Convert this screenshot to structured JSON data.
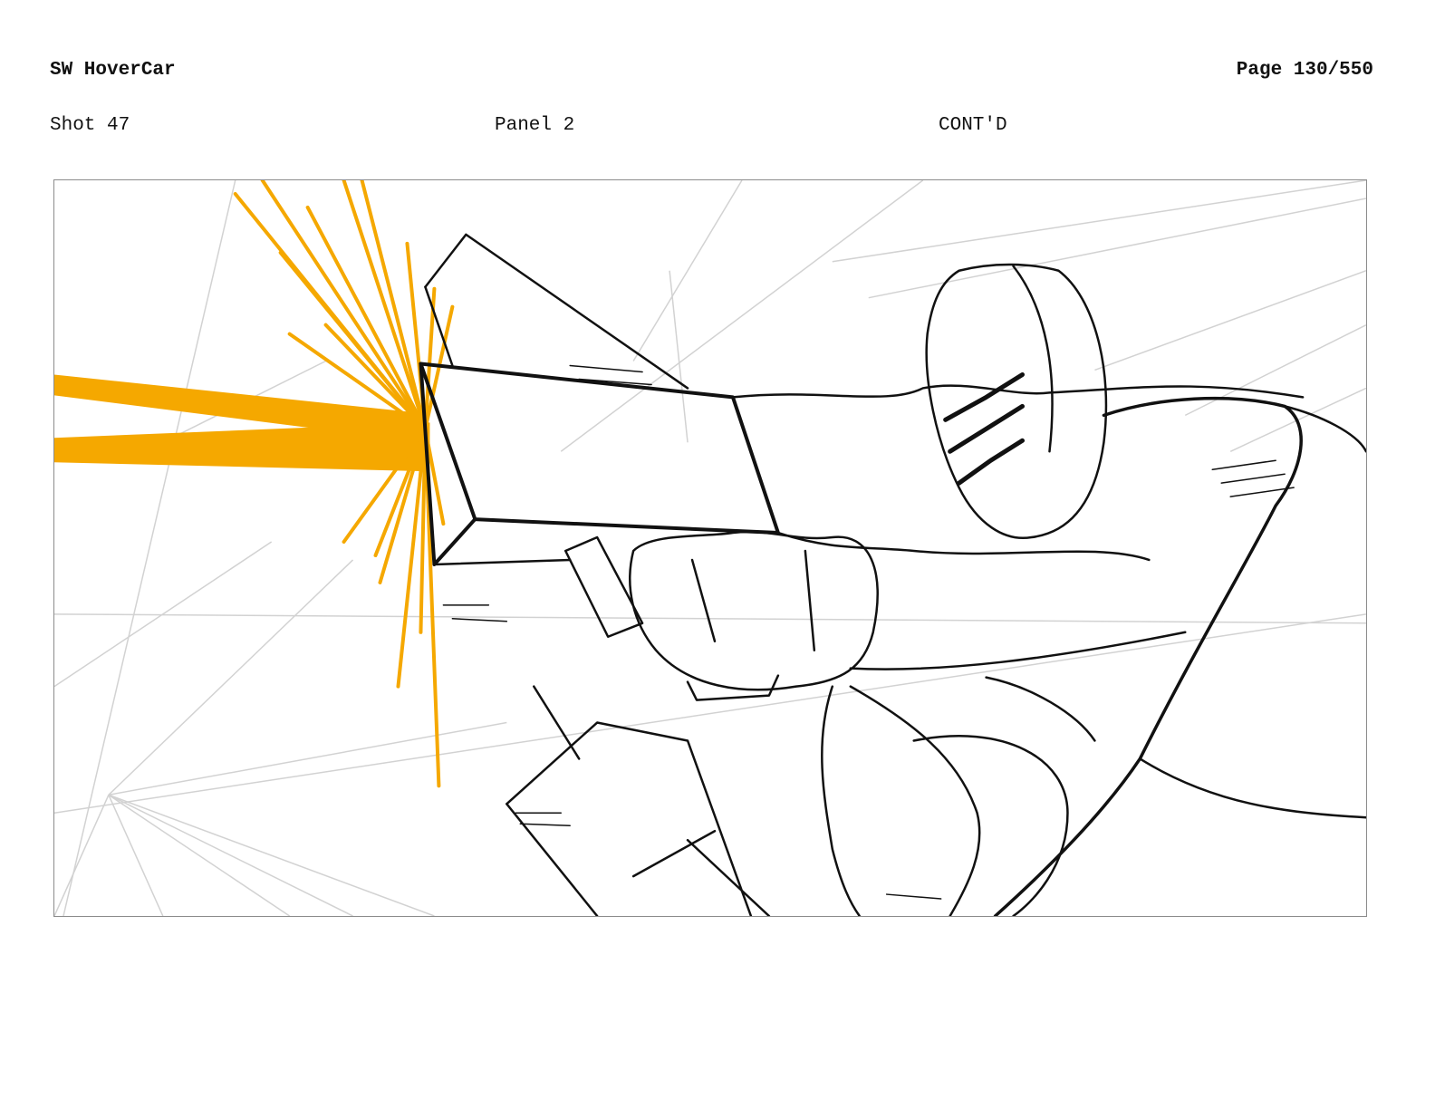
{
  "header": {
    "project_title": "SW HoverCar",
    "page_label": "Page 130/550"
  },
  "shot_info": {
    "shot_label": "Shot 47",
    "panel_label": "Panel 2",
    "continuation_label": "CONT'D"
  },
  "colors": {
    "blast": "#F5A800",
    "ink": "#111111",
    "construction_lines": "#cfcfcf",
    "frame_border": "#8c8c8c"
  }
}
